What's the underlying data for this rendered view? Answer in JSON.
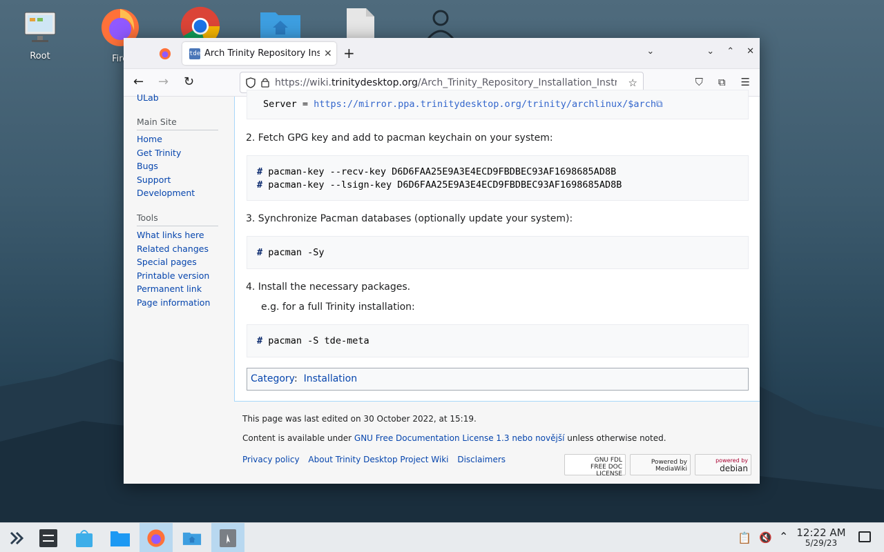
{
  "desktop": {
    "icons": [
      {
        "label": "Root",
        "icon": "computer-icon"
      },
      {
        "label": "Firef",
        "icon": "firefox-icon"
      },
      {
        "label": "",
        "icon": "chrome-icon"
      },
      {
        "label": "",
        "icon": "home-folder-icon"
      },
      {
        "label": "",
        "icon": "file-icon"
      },
      {
        "label": "",
        "icon": "user-icon"
      }
    ]
  },
  "browser": {
    "tab_title": "Arch Trinity Repository Installation Instructions",
    "favicon_text": "tde",
    "url_prefix": "https://wiki.",
    "url_domain": "trinitydesktop.org",
    "url_path": "/Arch_Trinity_Repository_Installation_Instructions"
  },
  "sidebar": {
    "top_partial": "ULab",
    "main_site_heading": "Main Site",
    "main_site_links": [
      "Home",
      "Get Trinity",
      "Bugs",
      "Support",
      "Development"
    ],
    "tools_heading": "Tools",
    "tools_links": [
      "What links here",
      "Related changes",
      "Special pages",
      "Printable version",
      "Permanent link",
      "Page information"
    ]
  },
  "content": {
    "server_key": "Server = ",
    "server_url": "https://mirror.ppa.trinitydesktop.org/trinity/archlinux/$arch",
    "step2": "2. Fetch GPG key and add to pacman keychain on your system:",
    "step2_cmd1": "pacman-key --recv-key  D6D6FAA25E9A3E4ECD9FBDBEC93AF1698685AD8B",
    "step2_cmd2": "pacman-key --lsign-key D6D6FAA25E9A3E4ECD9FBDBEC93AF1698685AD8B",
    "step3": "3. Synchronize Pacman databases (optionally update your system):",
    "step3_cmd": "pacman -Sy",
    "step4": "4. Install the necessary packages.",
    "step4_sub": "e.g. for a full Trinity installation:",
    "step4_cmd": "pacman -S tde-meta",
    "prompt": "#",
    "category_label": "Category",
    "category_value": "Installation"
  },
  "footer": {
    "last_edited": "This page was last edited on 30 October 2022, at 15:19.",
    "content_prefix": "Content is available under ",
    "license_link": "GNU Free Documentation License 1.3 nebo novější",
    "content_suffix": " unless otherwise noted.",
    "links": [
      "Privacy policy",
      "About Trinity Desktop Project Wiki",
      "Disclaimers"
    ],
    "badge_gfdl": [
      "GNU FDL",
      "FREE DOC",
      "LICENSE"
    ],
    "badge_mw": [
      "Powered by",
      "MediaWiki"
    ],
    "badge_debian": [
      "powered by",
      "debian"
    ]
  },
  "taskbar": {
    "time": "12:22 AM",
    "date": "5/29/23"
  },
  "colors": {
    "link": "#0645ad",
    "taskbar_active": "#b8d8f0"
  }
}
